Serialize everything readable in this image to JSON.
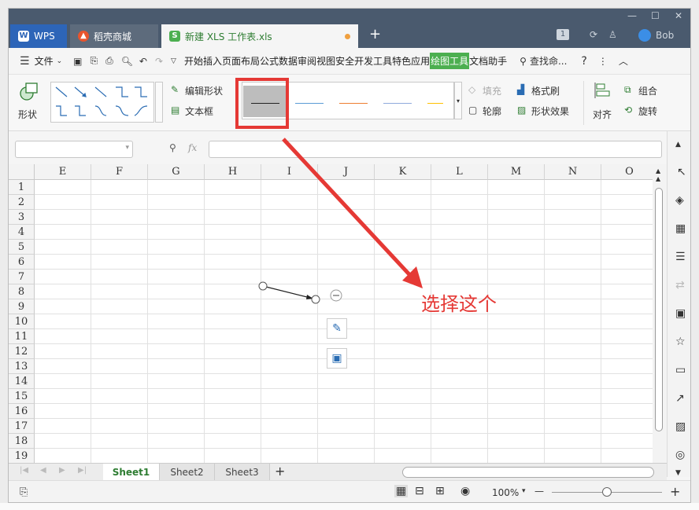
{
  "window": {
    "tabs": [
      {
        "label": "WPS"
      },
      {
        "label": "稻壳商城"
      },
      {
        "label": "新建 XLS 工作表.xls"
      }
    ],
    "notification_count": "1",
    "user": "Bob"
  },
  "menubar": {
    "file": "文件",
    "items": [
      "开始",
      "插入",
      "页面布局",
      "公式",
      "数据",
      "审阅",
      "视图",
      "安全",
      "开发工具",
      "特色应用"
    ],
    "active": "绘图工具",
    "after_active": "文档助手",
    "search": "查找命..."
  },
  "ribbon": {
    "shape": "形状",
    "edit_shape": "编辑形状",
    "text_box": "文本框",
    "fill": "填充",
    "format_painter": "格式刷",
    "outline": "轮廓",
    "shape_effects": "形状效果",
    "align": "对齐",
    "group": "组合",
    "rotate": "旋转",
    "line_styles": [
      {
        "color": "#222222",
        "selected": true
      },
      {
        "color": "#5b9bd5",
        "selected": false
      },
      {
        "color": "#ed7d31",
        "selected": false
      },
      {
        "color": "#8faadc",
        "selected": false
      },
      {
        "color": "#ffc000",
        "selected": false
      }
    ]
  },
  "formula_bar": {
    "fx": "fx",
    "name_box": "",
    "formula": ""
  },
  "grid": {
    "columns": [
      "E",
      "F",
      "G",
      "H",
      "I",
      "J",
      "K",
      "L",
      "M",
      "N",
      "O"
    ],
    "rows": [
      "1",
      "2",
      "3",
      "4",
      "5",
      "6",
      "7",
      "8",
      "9",
      "10",
      "11",
      "12",
      "13",
      "14",
      "15",
      "16",
      "17",
      "18",
      "19"
    ]
  },
  "sheets": [
    {
      "label": "Sheet1",
      "active": true
    },
    {
      "label": "Sheet2",
      "active": false
    },
    {
      "label": "Sheet3",
      "active": false
    }
  ],
  "status": {
    "zoom": "100%"
  },
  "annotation": {
    "text": "选择这个",
    "color": "#e53935"
  }
}
